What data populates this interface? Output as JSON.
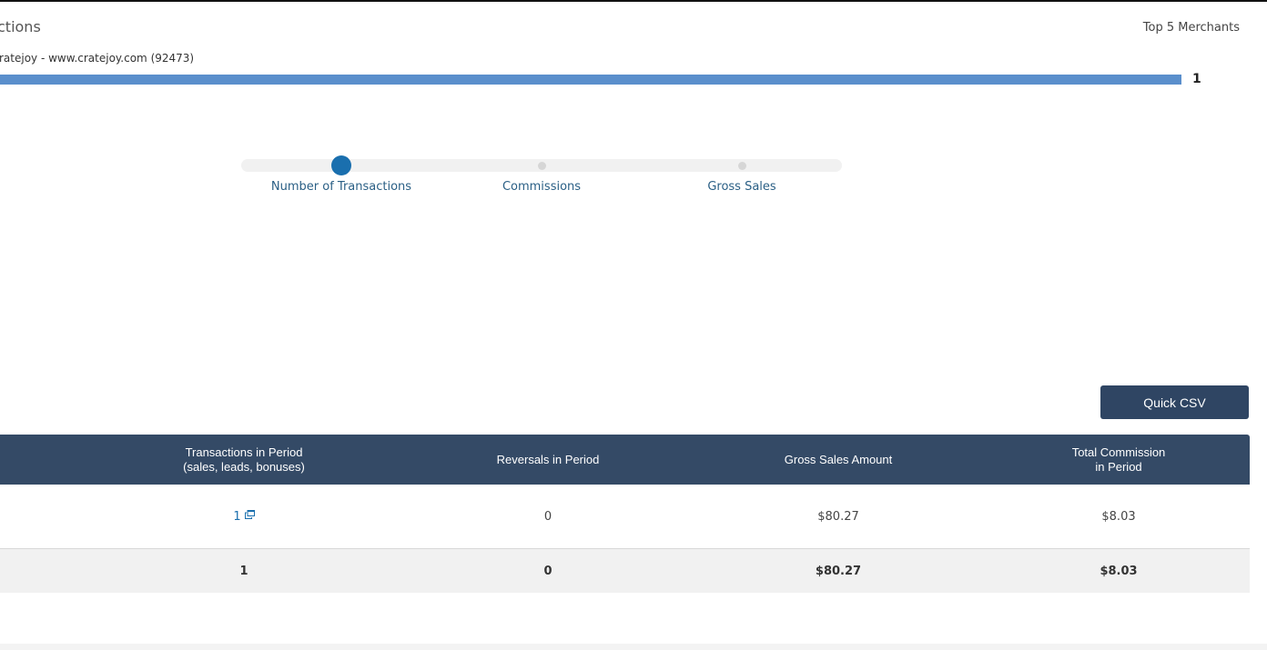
{
  "chart": {
    "title": "ctions",
    "top_merchants_label": "Top 5 Merchants",
    "merchant_label": "ratejoy - www.cratejoy.com (92473)",
    "bar_value": "1",
    "bar_fraction": 1.0,
    "bar_color": "#5a8fcc"
  },
  "metric_slider": {
    "selected_index": 0,
    "options": [
      {
        "label": "Number of Transactions"
      },
      {
        "label": "Commissions"
      },
      {
        "label": "Gross Sales"
      }
    ],
    "active_color": "#1a6fae"
  },
  "toolbar": {
    "quick_csv_label": "Quick CSV"
  },
  "table": {
    "header_color": "#344a66",
    "columns": [
      {
        "line1": "Transactions in Period",
        "line2": "(sales, leads, bonuses)"
      },
      {
        "line1": "Reversals in Period",
        "line2": ""
      },
      {
        "line1": "Gross Sales Amount",
        "line2": ""
      },
      {
        "line1": "Total Commission",
        "line2": "in Period"
      }
    ],
    "rows": [
      {
        "transactions": "1",
        "reversals": "0",
        "gross_sales": "$80.27",
        "commission": "$8.03",
        "transactions_icon": "popout-icon"
      }
    ],
    "totals": {
      "transactions": "1",
      "reversals": "0",
      "gross_sales": "$80.27",
      "commission": "$8.03"
    }
  }
}
